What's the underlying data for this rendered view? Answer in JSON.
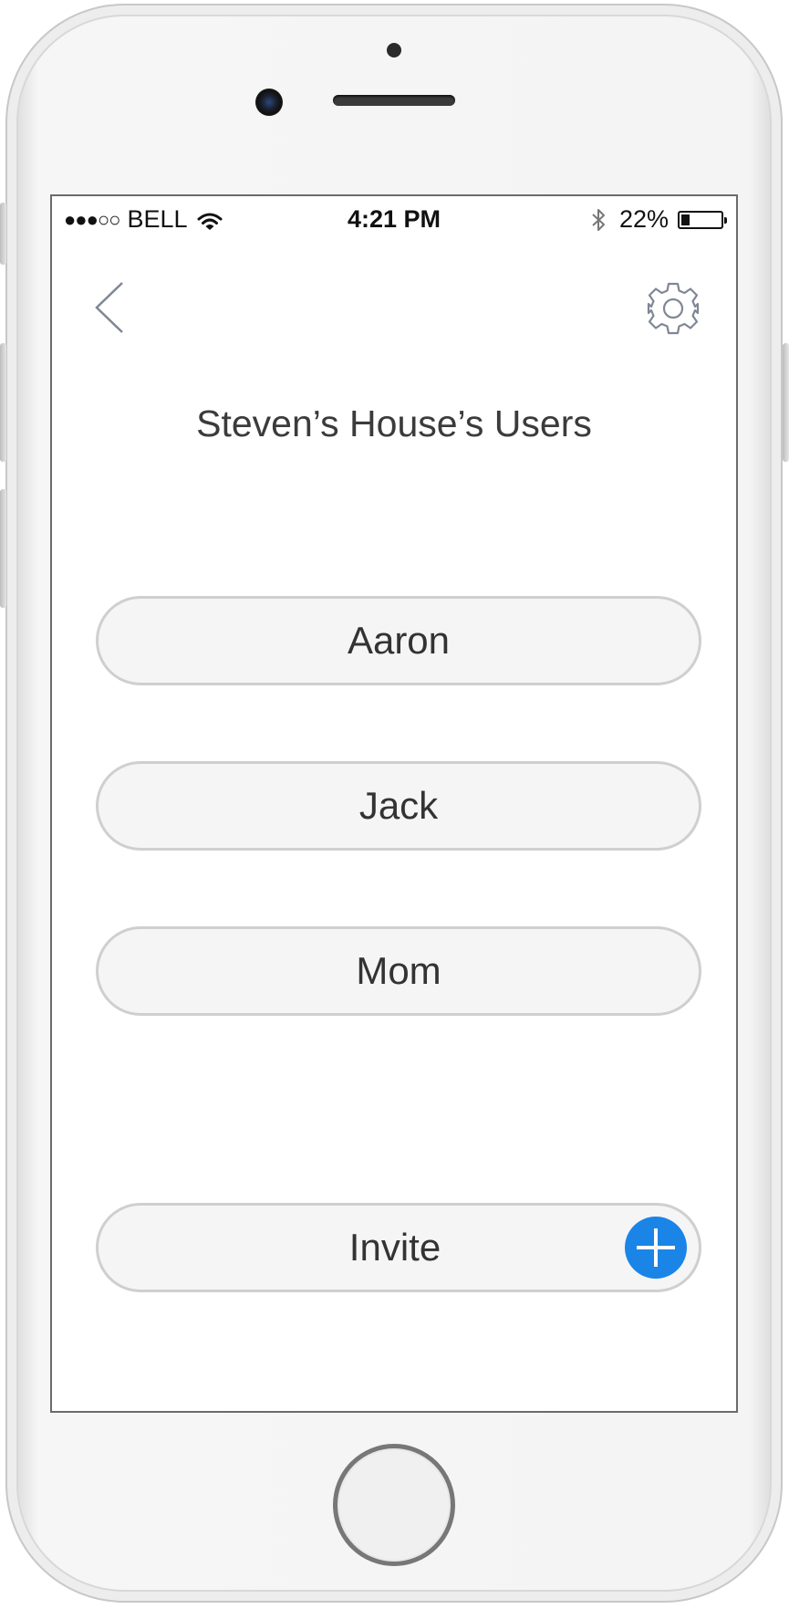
{
  "status_bar": {
    "signal": "●●●○○",
    "carrier": "BELL",
    "time": "4:21 PM",
    "battery_percent": "22%",
    "battery_level": 0.22
  },
  "header": {
    "back_icon": "chevron-left-icon",
    "settings_icon": "gear-icon",
    "title": "Steven’s House’s Users"
  },
  "users": [
    {
      "name": "Aaron"
    },
    {
      "name": "Jack"
    },
    {
      "name": "Mom"
    }
  ],
  "invite": {
    "label": "Invite",
    "icon": "plus-icon",
    "accent_color": "#1A85E6"
  }
}
